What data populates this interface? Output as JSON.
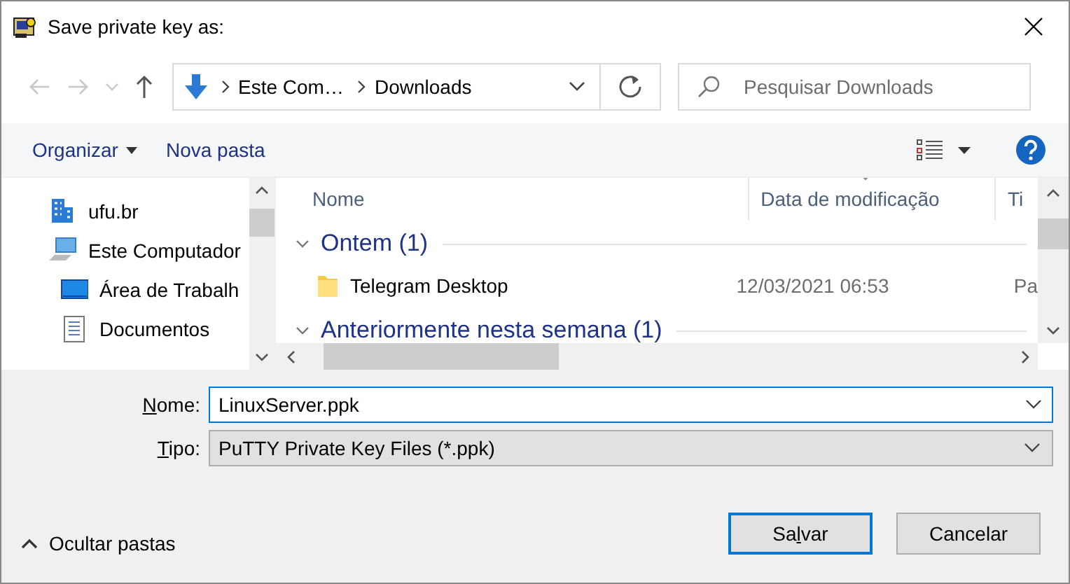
{
  "window": {
    "title": "Save private key as:"
  },
  "nav": [
    {
      "kind": "back",
      "disabled": true
    },
    {
      "kind": "forward",
      "disabled": true
    },
    {
      "kind": "recent",
      "disabled": true
    },
    {
      "kind": "up",
      "disabled": false
    }
  ],
  "address": {
    "segments": [
      "Este Com…",
      "Downloads"
    ]
  },
  "search": {
    "placeholder": "Pesquisar Downloads"
  },
  "toolbar": {
    "organize": "Organizar",
    "new_folder": "Nova pasta"
  },
  "sidebar": {
    "items": [
      {
        "label": "ufu.br",
        "kind": "network"
      },
      {
        "label": "Este Computador",
        "kind": "computer",
        "children": [
          {
            "label": "Área de Trabalh",
            "kind": "desktop"
          },
          {
            "label": "Documentos",
            "kind": "documents"
          }
        ]
      }
    ]
  },
  "columns": [
    {
      "label": "Nome",
      "sorted": false
    },
    {
      "label": "Data de modificação",
      "sorted": true
    },
    {
      "label": "Ti",
      "sorted": false
    }
  ],
  "groups": [
    {
      "label": "Ontem (1)",
      "expanded": true,
      "rows": [
        {
          "name": "Telegram Desktop",
          "date": "12/03/2021 06:53",
          "type": "Pa"
        }
      ]
    },
    {
      "label": "Anteriormente nesta semana (1)",
      "expanded": true
    }
  ],
  "form": {
    "name_field": {
      "label": [
        {
          "text": "N",
          "mnemonic": true
        },
        {
          "text": "ome:",
          "mnemonic": false
        }
      ],
      "value": "LinuxServer.ppk"
    },
    "type_field": {
      "label": [
        {
          "text": "T",
          "mnemonic": true
        },
        {
          "text": "ipo:",
          "mnemonic": false
        }
      ],
      "value": "PuTTY Private Key Files (*.ppk)"
    }
  },
  "hide_folders": "Ocultar pastas",
  "buttons": [
    {
      "label": [
        {
          "text": "Sa",
          "mnemonic": false
        },
        {
          "text": "l",
          "mnemonic": true
        },
        {
          "text": "var",
          "mnemonic": false
        }
      ],
      "default": true
    },
    {
      "label": [
        {
          "text": "Cancelar",
          "mnemonic": false
        }
      ],
      "default": false
    }
  ]
}
